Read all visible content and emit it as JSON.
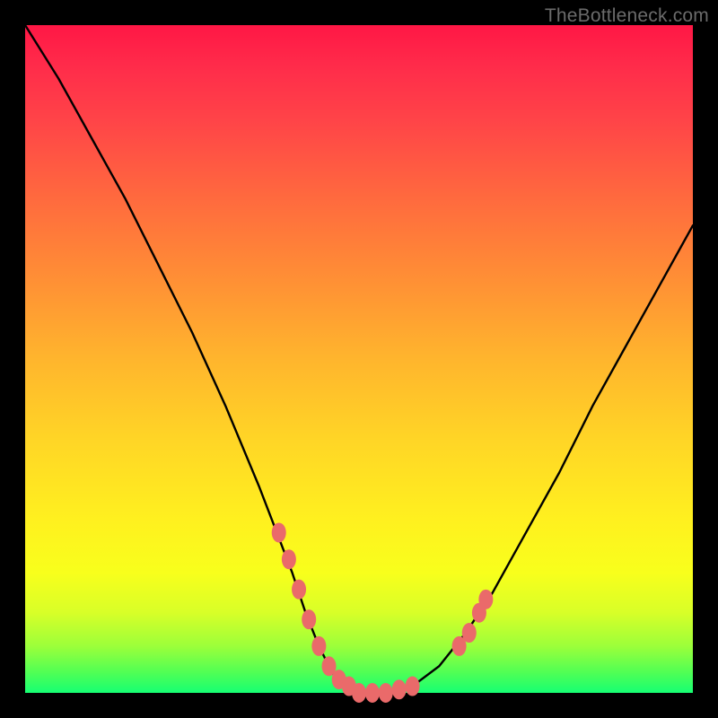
{
  "watermark": "TheBottleneck.com",
  "colors": {
    "frame": "#000000",
    "curve_stroke": "#000000",
    "bead": "#ea6a6a",
    "gradient_top": "#ff1745",
    "gradient_bottom": "#16ff73"
  },
  "chart_data": {
    "type": "line",
    "title": "",
    "xlabel": "",
    "ylabel": "",
    "xlim": [
      0,
      100
    ],
    "ylim": [
      0,
      100
    ],
    "grid": false,
    "legend": false,
    "series": [
      {
        "name": "curve",
        "x": [
          0,
          5,
          10,
          15,
          20,
          25,
          30,
          35,
          40,
          42,
          44,
          46,
          48,
          50,
          52,
          55,
          58,
          62,
          66,
          70,
          75,
          80,
          85,
          90,
          95,
          100
        ],
        "y": [
          100,
          92,
          83,
          74,
          64,
          54,
          43,
          31,
          18,
          12,
          7,
          3,
          1,
          0,
          0,
          0,
          1,
          4,
          9,
          15,
          24,
          33,
          43,
          52,
          61,
          70
        ]
      }
    ],
    "markers": [
      {
        "x": 38,
        "y": 24
      },
      {
        "x": 39.5,
        "y": 20
      },
      {
        "x": 41,
        "y": 15.5
      },
      {
        "x": 42.5,
        "y": 11
      },
      {
        "x": 44,
        "y": 7
      },
      {
        "x": 45.5,
        "y": 4
      },
      {
        "x": 47,
        "y": 2
      },
      {
        "x": 48.5,
        "y": 1
      },
      {
        "x": 50,
        "y": 0
      },
      {
        "x": 52,
        "y": 0
      },
      {
        "x": 54,
        "y": 0
      },
      {
        "x": 56,
        "y": 0.5
      },
      {
        "x": 58,
        "y": 1
      },
      {
        "x": 65,
        "y": 7
      },
      {
        "x": 66.5,
        "y": 9
      },
      {
        "x": 68,
        "y": 12
      },
      {
        "x": 69,
        "y": 14
      }
    ]
  }
}
